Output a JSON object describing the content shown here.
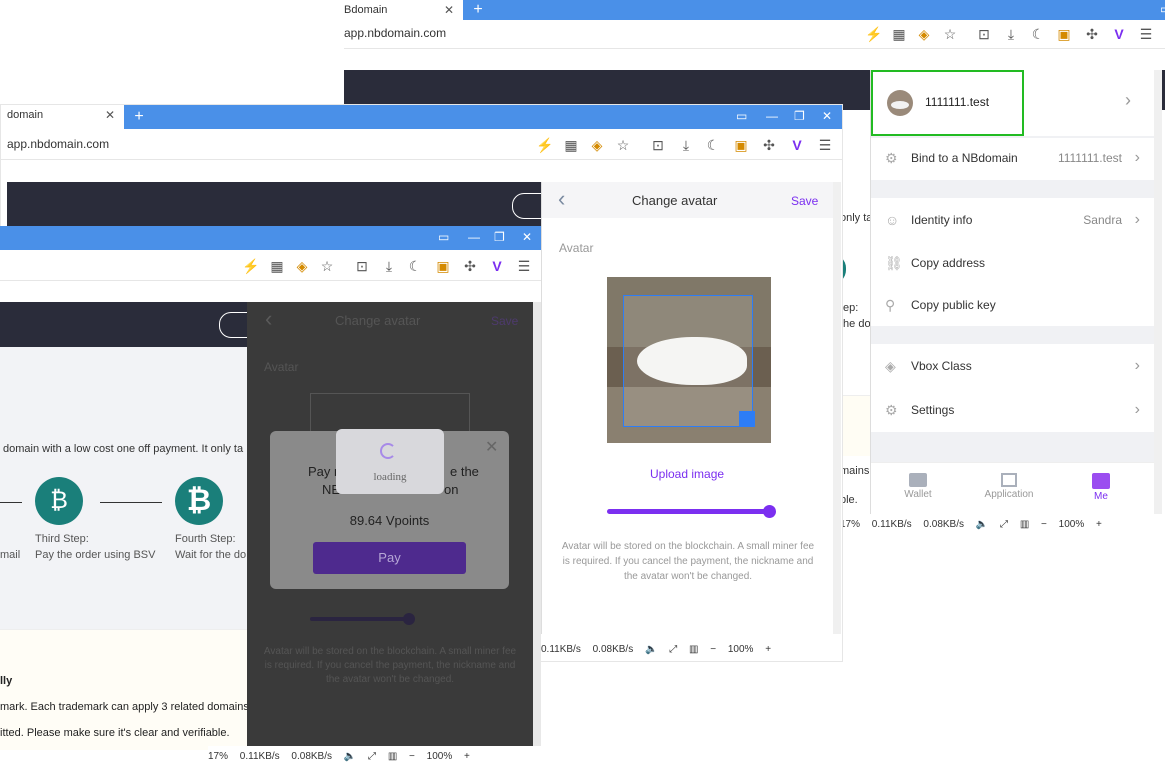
{
  "win1": {
    "tab_title": "Bdomain",
    "url": "app.nbdomain.com",
    "account_name": "1111111.test",
    "menu": [
      {
        "label": "Bind to a NBdomain",
        "value": "1111111.test"
      },
      {
        "label": "Identity info",
        "value": "Sandra"
      },
      {
        "label": "Copy address",
        "value": ""
      },
      {
        "label": "Copy public key",
        "value": ""
      },
      {
        "label": "Vbox Class",
        "value": ""
      },
      {
        "label": "Settings",
        "value": ""
      }
    ],
    "bottom_nav": {
      "wallet": "Wallet",
      "application": "Application",
      "me": "Me"
    },
    "right_peek": {
      "a": "mains",
      "b": "ble.",
      "c": "only ta",
      "d": "tep:",
      "e": "the do"
    },
    "status": {
      "cpu": "17%",
      "down": "0.11KB/s",
      "up": "0.08KB/s",
      "zoom": "100%"
    }
  },
  "win2": {
    "tab_title": "domain",
    "url": "app.nbdomain.com",
    "header": {
      "title": "Change avatar",
      "save": "Save"
    },
    "avatar_label": "Avatar",
    "upload": "Upload image",
    "note": "Avatar will be stored on the blockchain. A small miner fee is required. If you cancel the payment, the nickname and the avatar won't be changed.",
    "status": {
      "down": "0.11KB/s",
      "up": "0.08KB/s",
      "zoom": "100%"
    }
  },
  "win3": {
    "page_text": "domain with a low cost one off payment. It only ta",
    "steps": [
      {
        "title": "Third Step:",
        "desc": "Pay the order using BSV"
      },
      {
        "title": "Fourth Step:",
        "desc": "Wait for the do"
      }
    ],
    "left_peek": "mail",
    "bold_text": "lly",
    "para1": "mark. Each trademark can apply 3 related domains",
    "para2": "itted. Please make sure it's clear and verifiable.",
    "overlay": {
      "title": "Change avatar",
      "save": "Save",
      "avatar_label": "Avatar",
      "note": "Avatar will be stored on the blockchain. A small miner fee is required. If you cancel the payment, the nickname and the avatar won't be changed.",
      "modal_text_left": "Pay n",
      "modal_text_right": "e the",
      "modal_text2_left": "NE",
      "modal_text2_right": "on",
      "amount": "89.64 Vpoints",
      "pay": "Pay",
      "loading": "loading"
    },
    "status": {
      "cpu": "17%",
      "down": "0.11KB/s",
      "up": "0.08KB/s",
      "zoom": "100%"
    }
  },
  "colors": {
    "accent": "#7b2ff0",
    "tab_blue": "#4a90e8",
    "header_dark": "#2a2c3a",
    "highlight": "#22bb22",
    "bitcoin_green": "#1a7f7a"
  },
  "icons": [
    "bolt-icon",
    "grid-icon",
    "extension-icon",
    "star-icon",
    "crop-icon",
    "download-icon",
    "moon-icon",
    "bookmark-icon",
    "puzzle-icon",
    "v-icon",
    "menu-icon"
  ]
}
